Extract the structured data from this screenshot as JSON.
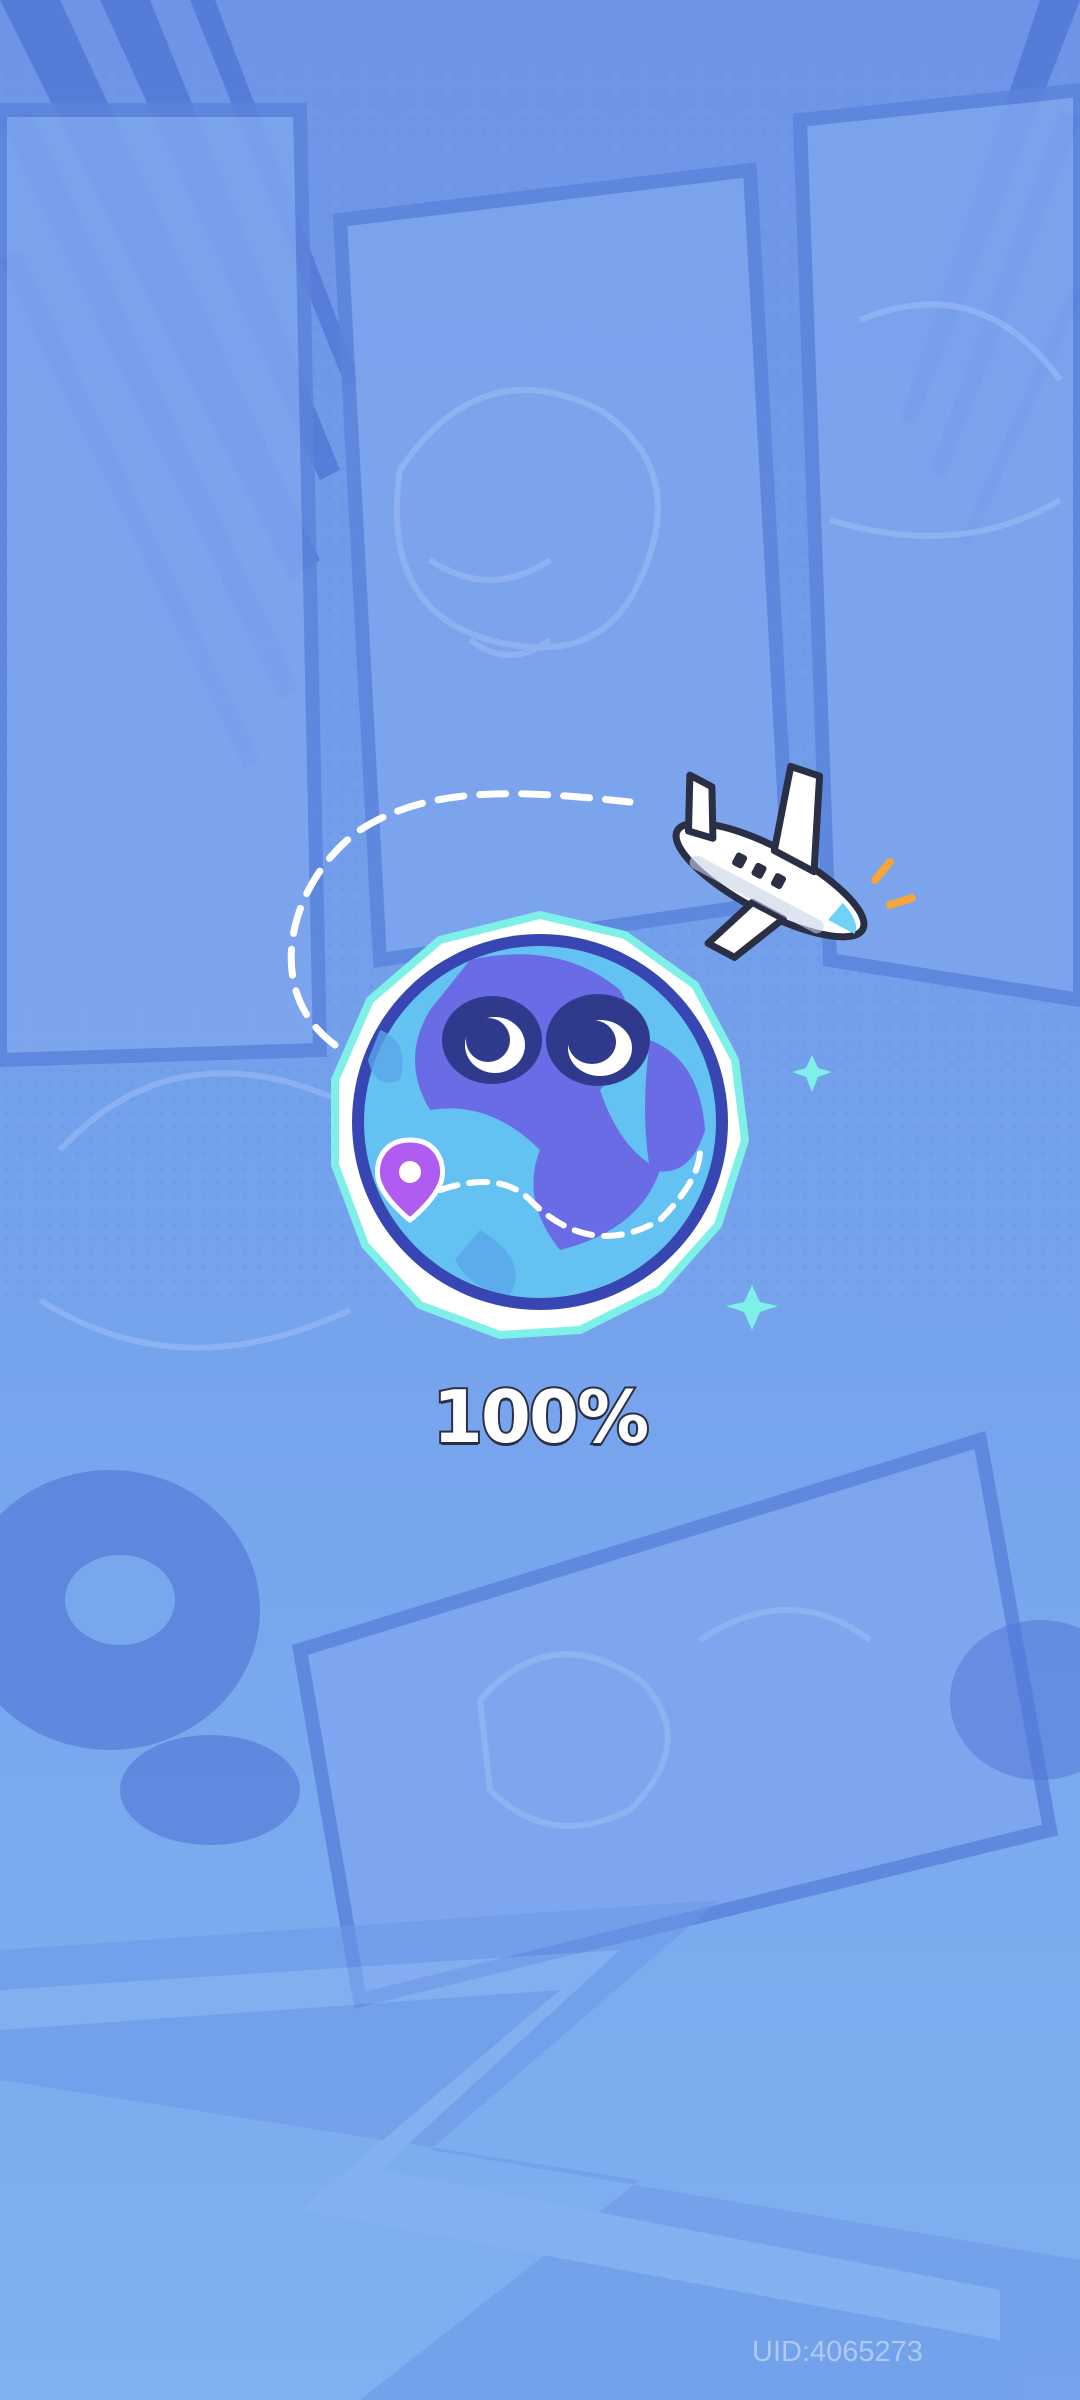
{
  "screen": {
    "type": "loading-screen",
    "background_color": "#7aa8ef",
    "accent_color": "#5b6ee8"
  },
  "loading": {
    "progress_percent": 100,
    "progress_label": "100%",
    "illustration": {
      "globe_icon": "globe-with-eyes-icon",
      "airplane_icon": "airplane-icon",
      "pin_icon": "location-pin-icon",
      "sparkle_icon": "sparkle-icon"
    }
  },
  "footer": {
    "uid_label": "UID:4065273"
  }
}
